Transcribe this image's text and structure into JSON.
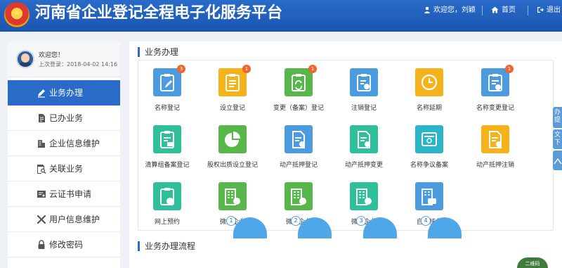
{
  "header": {
    "title": "河南省企业登记全程电子化服务平台",
    "welcome": "欢迎您，刘颖",
    "home": "首页",
    "logout": "退出",
    "colors": {
      "bar": "#2a6bc9"
    }
  },
  "sidebar": {
    "user": {
      "greeting": "欢迎您！",
      "last_login": "上次登录：2018-04-02 14:16"
    },
    "items": [
      {
        "label": "业务办理",
        "icon": "pen-icon",
        "active": true
      },
      {
        "label": "已办业务",
        "icon": "document-icon"
      },
      {
        "label": "企业信息维护",
        "icon": "building-icon"
      },
      {
        "label": "关联业务",
        "icon": "search-document-icon"
      },
      {
        "label": "云证书申请",
        "icon": "certificate-icon"
      },
      {
        "label": "用户信息维护",
        "icon": "tools-icon"
      },
      {
        "label": "修改密码",
        "icon": "lock-icon"
      }
    ]
  },
  "main": {
    "biz_title": "业务办理",
    "flow_title": "业务办理流程",
    "services": [
      {
        "label": "名称登记",
        "color": "#4a9be0",
        "badge": "3",
        "icon": "clipboard-pen-icon"
      },
      {
        "label": "设立登记",
        "color": "#f5b21b",
        "badge": "1",
        "icon": "clipboard-list-icon"
      },
      {
        "label": "变更（备案）登记",
        "color": "#57b74a",
        "badge": "1",
        "icon": "clipboard-refresh-icon"
      },
      {
        "label": "注销登记",
        "color": "#4a9be0",
        "badge": "",
        "icon": "clipboard-cancel-icon"
      },
      {
        "label": "名称延期",
        "color": "#f5b21b",
        "badge": "",
        "icon": "clock-icon"
      },
      {
        "label": "名称变更登记",
        "color": "#4a9be0",
        "badge": "1",
        "icon": "clipboard-minus-icon"
      },
      {
        "label": "清算组备案登记",
        "color": "#2fbf9a",
        "badge": "",
        "icon": "clipboard-check-icon"
      },
      {
        "label": "股权出质设立登记",
        "color": "#57b74a",
        "badge": "",
        "icon": "pie-chart-icon"
      },
      {
        "label": "动产抵押登记",
        "color": "#4a9be0",
        "badge": "",
        "icon": "document-pen-icon"
      },
      {
        "label": "动产抵押变更",
        "color": "#2fbf9a",
        "badge": "",
        "icon": "document-minus-icon"
      },
      {
        "label": "名称争议备案",
        "color": "#2bb5c9",
        "badge": "",
        "icon": "id-card-icon"
      },
      {
        "label": "动产抵押注销",
        "color": "#f5b21b",
        "badge": "",
        "icon": "document-cancel-icon"
      },
      {
        "label": "网上预约",
        "color": "#2fbf9a",
        "badge": "",
        "icon": "clipboard-clock-icon"
      },
      {
        "label": "微型企业",
        "color": "#57b74a",
        "badge": "",
        "icon": "building-micro-icon"
      },
      {
        "label": "微型企业",
        "color": "#57b74a",
        "badge": "",
        "icon": "building-micro-icon"
      },
      {
        "label": "微型企业",
        "color": "#2fbf9a",
        "badge": "",
        "icon": "building-micro-icon"
      },
      {
        "label": "自主核名",
        "color": "#4a9be0",
        "badge": "",
        "icon": "building-id-icon"
      }
    ],
    "steps": [
      "1",
      "2",
      "3",
      "4"
    ]
  },
  "float_tabs": [
    "办提",
    "文下"
  ],
  "qr_badge": "二维码"
}
